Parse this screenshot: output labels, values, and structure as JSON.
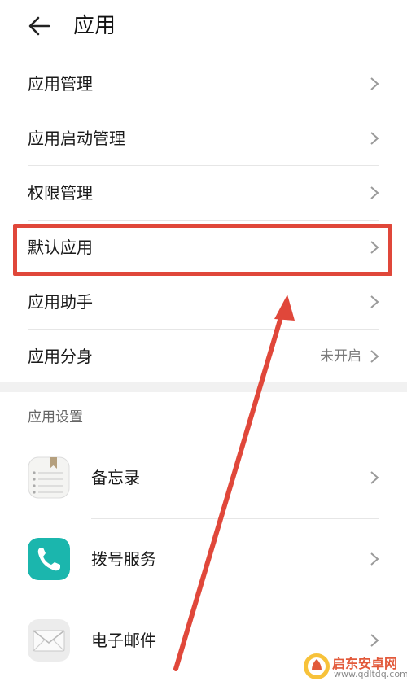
{
  "header": {
    "title": "应用"
  },
  "menu": [
    {
      "label": "应用管理",
      "status": ""
    },
    {
      "label": "应用启动管理",
      "status": ""
    },
    {
      "label": "权限管理",
      "status": ""
    },
    {
      "label": "默认应用",
      "status": ""
    },
    {
      "label": "应用助手",
      "status": ""
    },
    {
      "label": "应用分身",
      "status": "未开启"
    }
  ],
  "section": {
    "title": "应用设置"
  },
  "apps": [
    {
      "label": "备忘录",
      "icon": "notes-icon"
    },
    {
      "label": "拨号服务",
      "icon": "phone-icon"
    },
    {
      "label": "电子邮件",
      "icon": "mail-icon"
    }
  ],
  "annotation": {
    "highlight_color": "#e0473a"
  },
  "watermark": {
    "name": "启东安卓网",
    "url": "www.qdltdq.com"
  }
}
